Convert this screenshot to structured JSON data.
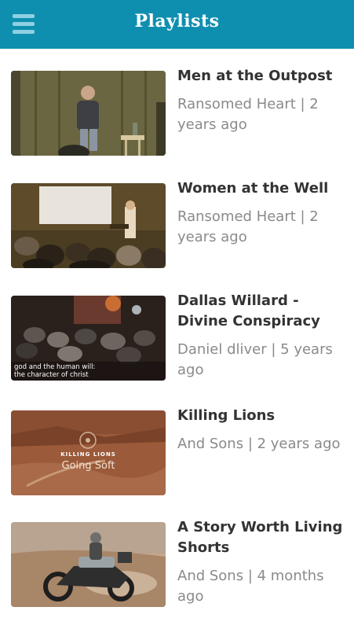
{
  "header": {
    "title": "Playlists",
    "menu_icon": "hamburger-menu-icon",
    "background_color": "#0f8fb0"
  },
  "playlists": [
    {
      "title": "Men at the Outpost",
      "channel": "Ransomed Heart",
      "age": "2 years ago",
      "meta": "Ransomed Heart | 2 years ago"
    },
    {
      "title": "Women at the Well",
      "channel": "Ransomed Heart",
      "age": "2 years ago",
      "meta": "Ransomed Heart | 2 years ago"
    },
    {
      "title": "Dallas Willard - Divine Conspiracy",
      "channel": "Daniel dliver",
      "age": "5 years ago",
      "meta": "Daniel dliver | 5 years ago",
      "thumb_caption_line1": "god and the human will:",
      "thumb_caption_line2": "the character of christ"
    },
    {
      "title": "Killing Lions",
      "channel": "And Sons",
      "age": "2 years ago",
      "meta": "And Sons | 2 years ago",
      "thumb_caption_line1": "KILLING LIONS",
      "thumb_caption_line2": "Going Soft"
    },
    {
      "title": "A Story Worth Living Shorts",
      "channel": "And Sons",
      "age": "4 months ago",
      "meta": "And Sons | 4 months ago"
    }
  ]
}
